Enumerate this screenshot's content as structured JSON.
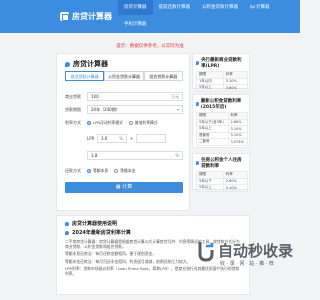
{
  "header": {
    "logo_text": "房贷计算器",
    "nav": [
      "房贷计算器",
      "提前还款计算器",
      "公积金贷款计算器",
      "lpr计算器",
      "手机计算器"
    ]
  },
  "notice": "提示：数据仅供参考，以实际为准",
  "main": {
    "title": "房贷计算器",
    "tabs": [
      "商业贷款计算器",
      "公积金贷款计算器",
      "组合贷款计算器"
    ],
    "fields": [
      {
        "label": "商业贷款",
        "value": "100",
        "unit": "万元"
      },
      {
        "label": "贷款期限",
        "value": "20年（240期）"
      },
      {
        "label": "利率方式",
        "options": [
          "LPR浮动利率模式",
          "基准利率模式"
        ]
      },
      {
        "label": "LPR",
        "value": "3.6",
        "unit": "%"
      },
      {
        "label": "利率",
        "value": "3.8",
        "unit": "%"
      },
      {
        "label": "还款方式",
        "options": [
          "等额本息",
          "等额本金"
        ]
      }
    ],
    "button": "计算"
  },
  "side1": {
    "title": "央行最新商业贷款利率(LPR)",
    "header": [
      "期限",
      "利率"
    ],
    "rows": [
      [
        "1年以内",
        "3.10%"
      ],
      [
        "5年以上",
        "3.60%"
      ]
    ]
  },
  "side2": {
    "title": "最新公积金贷款利率(2015年后)",
    "header": [
      "期限",
      "利率"
    ],
    "rows": [
      [
        "5年以下(含5年)",
        "2.60%"
      ],
      [
        "5年以上",
        "3.10%"
      ],
      [
        "首套房",
        "3.10%"
      ],
      [
        "二套房",
        "3.575%"
      ]
    ]
  },
  "side3": {
    "title": "住房公积金个人住房贷款利率",
    "header": [
      "期限",
      "利率"
    ],
    "rows": [
      [
        "5年以下",
        "2.60%"
      ],
      [
        "5年以上",
        "3.10%"
      ]
    ]
  },
  "info": {
    "title": "房贷计算器使用说明",
    "subtitle": "2024年最新房贷利率计算",
    "paragraphs": [
      "二手房房贷计算器：房贷计算器是根据房贷计算公式计算房贷月供、利息等情况的工具，按贷款方式分为商业贷款、公积金贷款和组合贷款。",
      "等额本息还款法：每月还款金额相同，便于规划资金。",
      "等额本金还款法：每月归还本金相同，利息逐月递减，前期还款压力较大。",
      "LPR利率：贷款市场报价利率（Loan Prime Rate，简称LPR），是商业银行对其最优质客户执行的贷款利率。"
    ]
  },
  "watermark": {
    "main": "自动秒收录",
    "sub": "收 · 录 · 网 · 站 · 推 · 荐"
  }
}
